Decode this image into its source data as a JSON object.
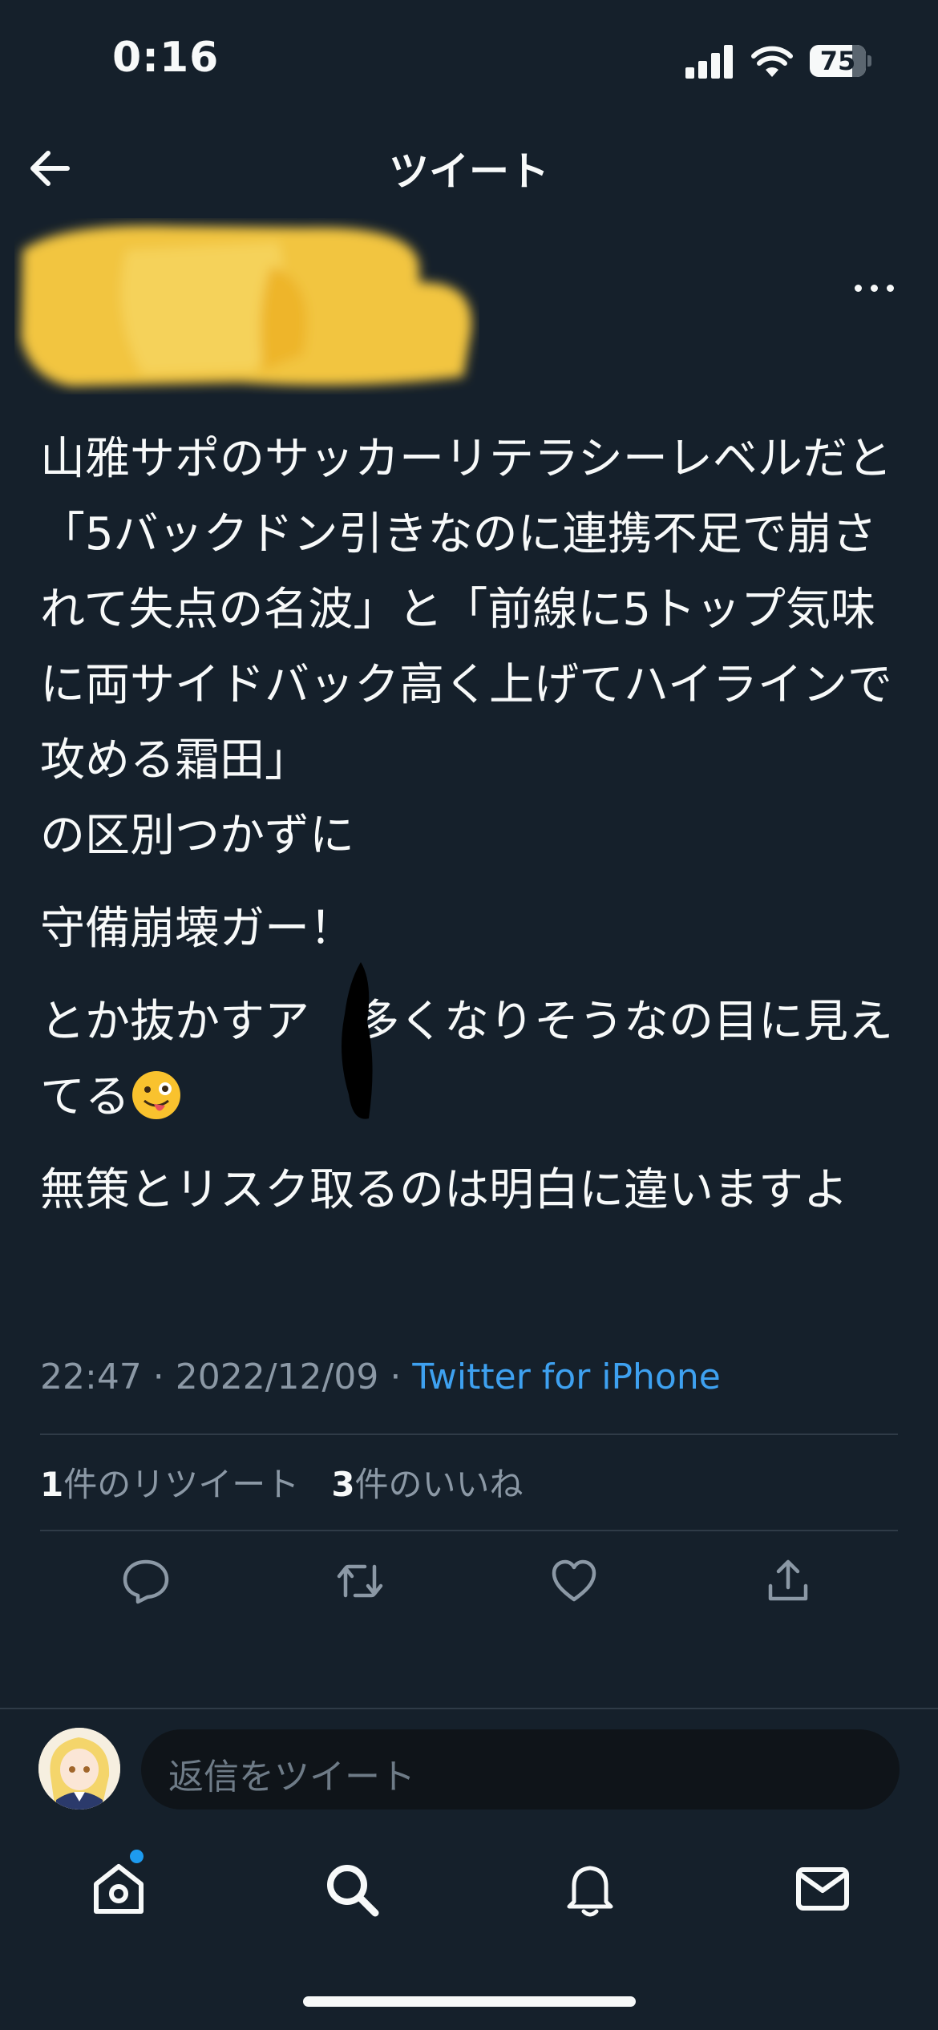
{
  "status_bar": {
    "time": "0:16",
    "battery": "75",
    "battery_level": 0.75
  },
  "header": {
    "title": "ツイート"
  },
  "tweet": {
    "paragraphs": [
      "山雅サポのサッカーリテラシーレベルだと「5バックドン引きなのに連携不足で崩されて失点の名波」と「前線に5トップ気味に両サイドバック高く上げてハイラインで攻める霜田」",
      "の区別つかずに",
      "守備崩壊ガー！",
      "とか抜かすア　多くなりそうなの目に見えてる",
      "無策とリスク取るのは明白に違いますよ"
    ],
    "timestamp": "22:47 · 2022/12/09 · ",
    "source": "Twitter for iPhone",
    "retweet_count": "1",
    "retweet_label": "件のリツイート",
    "like_count": "3",
    "like_label": "件のいいね"
  },
  "reply": {
    "placeholder": "返信をツイート"
  },
  "colors": {
    "background": "#15202b",
    "accent": "#1d9bf0",
    "muted": "#8b98a5",
    "divider": "#2f3b47"
  },
  "icons": {
    "back": "arrow-left-icon",
    "more": "more-dots-icon",
    "reply": "comment-icon",
    "retweet": "retweet-icon",
    "like": "heart-icon",
    "share": "share-icon",
    "home": "home-icon",
    "search": "search-icon",
    "notifications": "bell-icon",
    "messages": "mail-icon"
  }
}
